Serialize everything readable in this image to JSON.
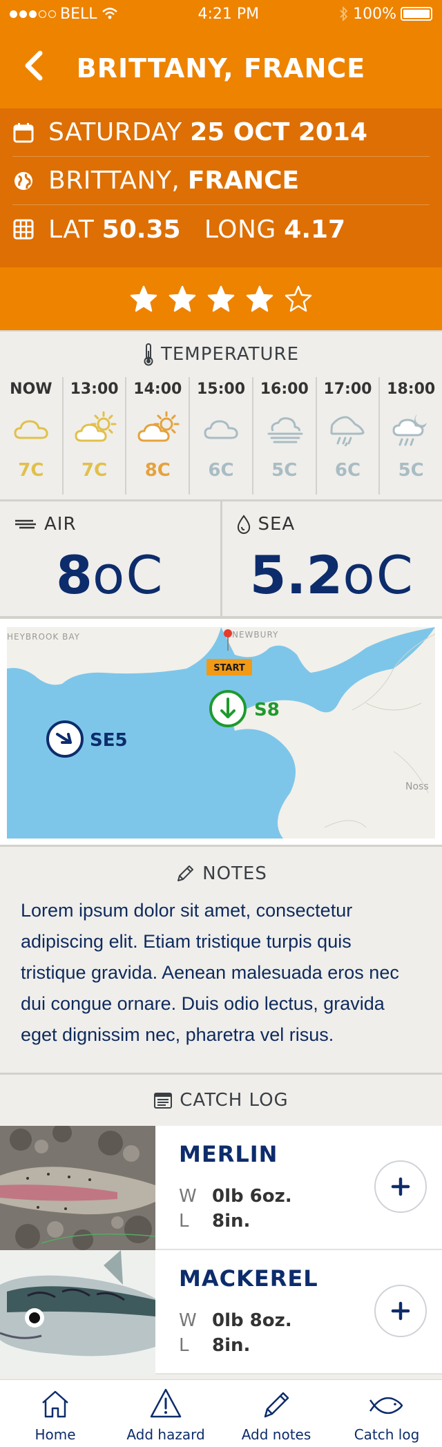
{
  "status": {
    "carrier": "BELL",
    "time": "4:21 PM",
    "battery": "100%",
    "signal_filled": 3,
    "signal_total": 5
  },
  "header": {
    "title": "BRITTANY, FRANCE"
  },
  "info": {
    "date_prefix": "SATURDAY",
    "date_value": "25 OCT 2014",
    "place_prefix": "BRITTANY,",
    "place_value": "FRANCE",
    "lat_label": "LAT",
    "lat_value": "50.35",
    "long_label": "LONG",
    "long_value": "4.17"
  },
  "rating": {
    "value": 4,
    "max": 5
  },
  "temperature": {
    "title": "TEMPERATURE",
    "hours": [
      {
        "time": "NOW",
        "icon": "cloud-icon",
        "value": "7C",
        "color": "#e1c04b"
      },
      {
        "time": "13:00",
        "icon": "sun-cloud-icon",
        "value": "7C",
        "color": "#e1c04b"
      },
      {
        "time": "14:00",
        "icon": "sun-cloud-icon",
        "value": "8C",
        "color": "#e5a23c"
      },
      {
        "time": "15:00",
        "icon": "cloud-icon",
        "value": "6C",
        "color": "#a9bcc3"
      },
      {
        "time": "16:00",
        "icon": "fog-icon",
        "value": "5C",
        "color": "#a9bcc3"
      },
      {
        "time": "17:00",
        "icon": "rain-icon",
        "value": "6C",
        "color": "#a9bcc3"
      },
      {
        "time": "18:00",
        "icon": "rain-moon-icon",
        "value": "5C",
        "color": "#a9bcc3"
      }
    ]
  },
  "air": {
    "label": "AIR",
    "value": "8",
    "unit": "oC"
  },
  "sea": {
    "label": "SEA",
    "value": "5.2",
    "unit": "oC"
  },
  "map": {
    "labels": {
      "bay": "HEYBROOK BAY",
      "town": "NEWBURY",
      "noss": "Noss"
    },
    "start_label": "START",
    "wind1": {
      "label": "SE5",
      "color": "#0d2c6b"
    },
    "wind2": {
      "label": "S8",
      "color": "#1e9a2e"
    }
  },
  "notes": {
    "title": "NOTES",
    "text": "Lorem ipsum dolor sit amet, consectetur adipiscing elit. Etiam tristique turpis quis tristique gravida. Aenean malesuada eros nec dui congue ornare. Duis odio lectus, gravida eget dignissim nec, pharetra vel risus."
  },
  "catch_log": {
    "title": "CATCH LOG",
    "items": [
      {
        "name": "MERLIN",
        "w_label": "W",
        "weight": "0lb 6oz.",
        "l_label": "L",
        "length": "8in."
      },
      {
        "name": "MACKEREL",
        "w_label": "W",
        "weight": "0lb 8oz.",
        "l_label": "L",
        "length": "8in."
      }
    ]
  },
  "tabs": [
    {
      "label": "Home",
      "icon": "home-icon"
    },
    {
      "label": "Add hazard",
      "icon": "hazard-icon"
    },
    {
      "label": "Add notes",
      "icon": "pencil-icon"
    },
    {
      "label": "Catch log",
      "icon": "fish-icon"
    }
  ],
  "colors": {
    "brand_orange": "#ee8300",
    "info_orange": "#dd6f04",
    "navy": "#0d2c6b",
    "green": "#1e9a2e",
    "sea_blue": "#7dc6ea"
  }
}
